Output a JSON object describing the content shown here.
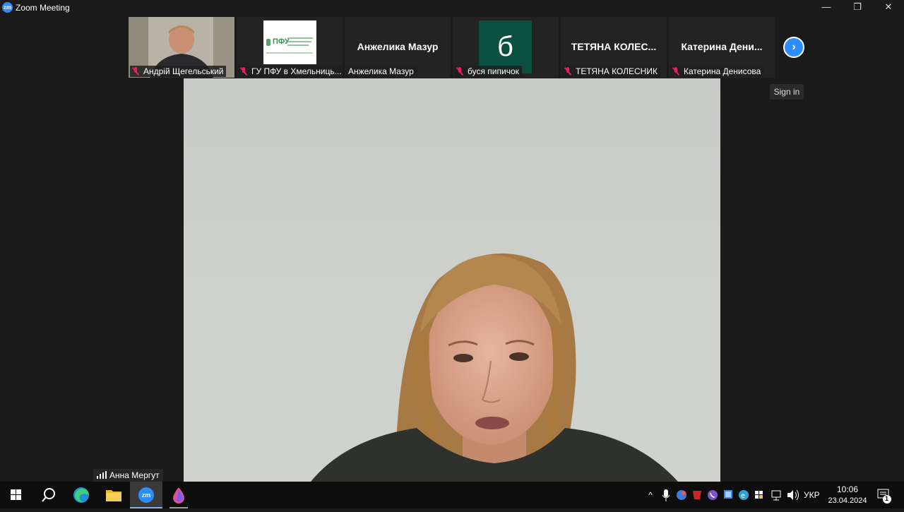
{
  "window": {
    "app_logo": "zm",
    "title": "Zoom Meeting",
    "minimize": "—",
    "restore": "❐",
    "close": "✕"
  },
  "participants": [
    {
      "name": "Андрій Щегельський",
      "video": true
    },
    {
      "name": "ГУ ПФУ в Хмельниць...",
      "video": true
    },
    {
      "name": "Анжелика Мазур",
      "big_label": "Анжелика Мазур"
    },
    {
      "name": "буся пипичок",
      "avatar_letter": "б"
    },
    {
      "name": "ТЕТЯНА КОЛЕСНИК",
      "big_label": "ТЕТЯНА  КОЛЕС..."
    },
    {
      "name": "Катерина Денисова",
      "big_label": "Катерина  Дени..."
    }
  ],
  "pfu_logo_text": "ПФУ",
  "next_page_icon": "chevron-right-icon",
  "sign_in_label": "Sign in",
  "active_speaker": "Анна Мергут",
  "taskbar": {
    "zoom_label": "zm",
    "language": "УКР",
    "time": "10:06",
    "date": "23.04.2024",
    "notification_count": "1"
  },
  "colors": {
    "zoom_blue": "#2d8cff",
    "mute_red": "#e0245e",
    "avatar_green": "#0b4f3f"
  }
}
